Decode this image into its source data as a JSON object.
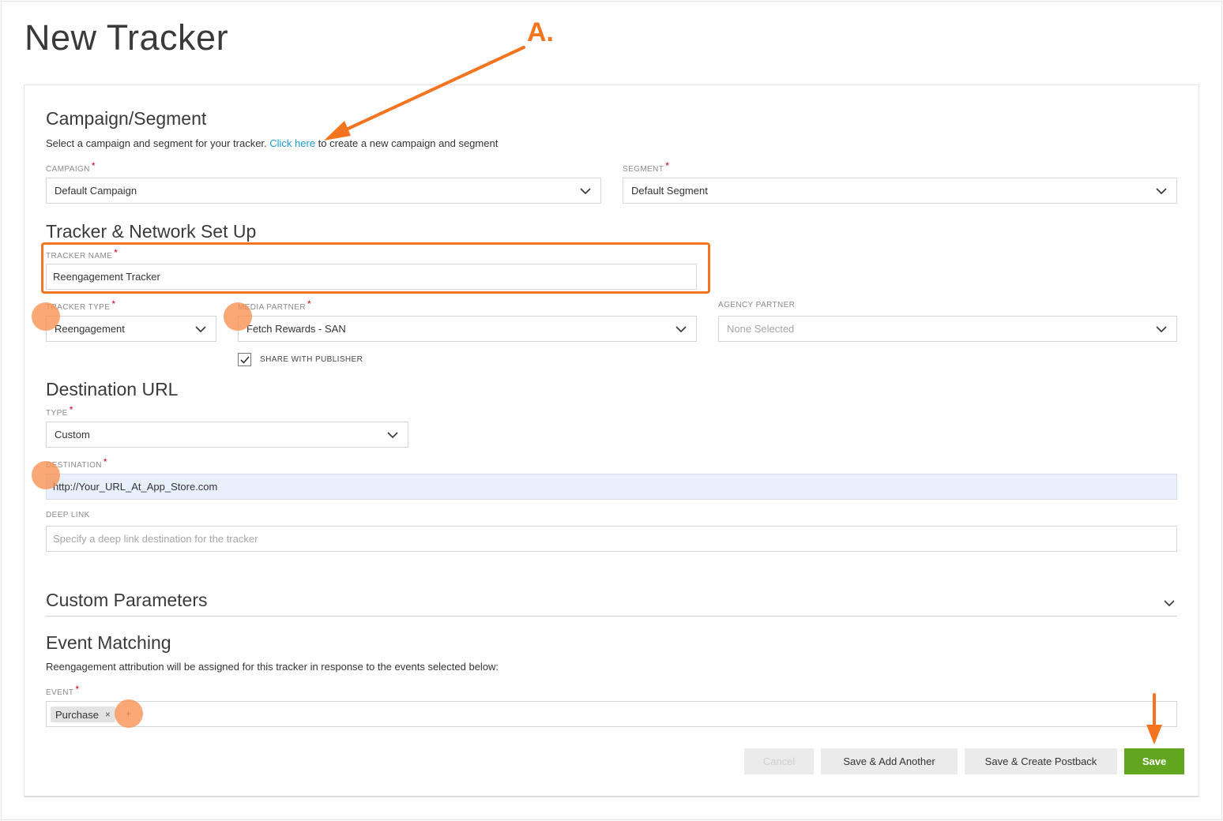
{
  "page": {
    "title": "New Tracker"
  },
  "campaign_segment": {
    "title": "Campaign/Segment",
    "desc_before": "Select a campaign and segment for your tracker. ",
    "link": "Click here",
    "desc_after": " to create a new campaign and segment",
    "campaign_label": "CAMPAIGN",
    "campaign_value": "Default Campaign",
    "segment_label": "SEGMENT",
    "segment_value": "Default Segment"
  },
  "tracker_setup": {
    "title": "Tracker & Network Set Up",
    "name_label": "TRACKER NAME",
    "name_value": "Reengagement Tracker",
    "type_label": "TRACKER TYPE",
    "type_value": "Reengagement",
    "media_label": "MEDIA PARTNER",
    "media_value": "Fetch Rewards - SAN",
    "agency_label": "AGENCY PARTNER",
    "agency_value": "None Selected",
    "share_label": "SHARE WITH PUBLISHER",
    "share_checked": true
  },
  "destination": {
    "title": "Destination URL",
    "type_label": "TYPE",
    "type_value": "Custom",
    "dest_label": "DESTINATION",
    "dest_value": "http://Your_URL_At_App_Store.com",
    "deeplink_label": "DEEP LINK",
    "deeplink_placeholder": "Specify a deep link destination for the tracker"
  },
  "custom_params": {
    "title": "Custom Parameters"
  },
  "event_matching": {
    "title": "Event Matching",
    "desc": "Reengagement attribution will be assigned for this tracker in response to the events selected below:",
    "event_label": "EVENT",
    "tags": [
      {
        "label": "Purchase",
        "remove": "×"
      }
    ],
    "add": "+"
  },
  "actions": {
    "cancel": "Cancel",
    "save_add": "Save & Add Another",
    "save_postback": "Save & Create Postback",
    "save": "Save"
  },
  "annotation": {
    "label": "A."
  },
  "colors": {
    "accent": "#f47420",
    "link": "#1a9cd6",
    "save": "#61a61e",
    "required": "#d0021b"
  }
}
